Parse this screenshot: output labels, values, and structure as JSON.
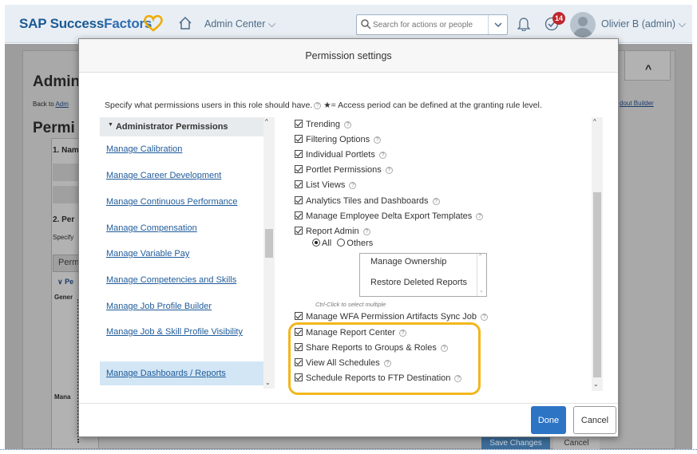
{
  "shell": {
    "logo_part1": "SAP Success",
    "logo_part2": "Factors",
    "module": "Admin Center",
    "module_chevron": "⌵",
    "search_placeholder": "Search for actions or people",
    "notification_count": "14",
    "user": "Olivier B (admin)",
    "user_chevron": "⌵",
    "brand_color": "#1b5a94",
    "heart_color": "#f0ab00"
  },
  "background": {
    "page_title": "Admin",
    "back_prefix": "Back to ",
    "back_link": "Adm",
    "section_title": "Permi",
    "step1": "1. Nam",
    "step2": "2. Per",
    "specify": "Specify",
    "perm_box": "Perm",
    "perm_link": "∨ Pe",
    "general": "Gener",
    "mana": "Mana",
    "right_link": "dout Builder",
    "collapse_icon": "^",
    "save_changes": "Save Changes",
    "cancel": "Cancel"
  },
  "dialog": {
    "title": "Permission settings",
    "description_part1": "Specify what permissions users in this role should have.",
    "description_part2": "★= Access period can be defined at the granting rule level.",
    "left_header": "Administrator Permissions",
    "left_items": [
      "Manage Calibration",
      "Manage Career Development",
      "Manage Continuous Performance",
      "Manage Compensation",
      "Manage Variable Pay",
      "Manage Competencies and Skills",
      "Manage Job Profile Builder",
      "Manage Job & Skill Profile Visibility",
      "Manage Dashboards / Reports"
    ],
    "right_items_top": [
      "Trending",
      "Filtering Options",
      "Individual Portlets",
      "Portlet Permissions",
      "List Views",
      "Analytics Tiles and Dashboards",
      "Manage Employee Delta Export Templates",
      "Report Admin"
    ],
    "radio_all": "All",
    "radio_others": "Others",
    "multi_options": [
      "Manage Ownership",
      "Restore Deleted Reports"
    ],
    "ctrl_hint": "Ctrl-Click to select multiple",
    "right_items_bottom": [
      "Manage WFA Permission Artifacts Sync Job",
      "Manage Report Center",
      "Share Reports to Groups & Roles",
      "View All Schedules",
      "Schedule Reports to FTP Destination"
    ],
    "done_label": "Done",
    "cancel_label": "Cancel",
    "help_glyph": "?",
    "scroll_up": "^",
    "scroll_down": "⌄",
    "highlight_color": "#f2b71c"
  }
}
